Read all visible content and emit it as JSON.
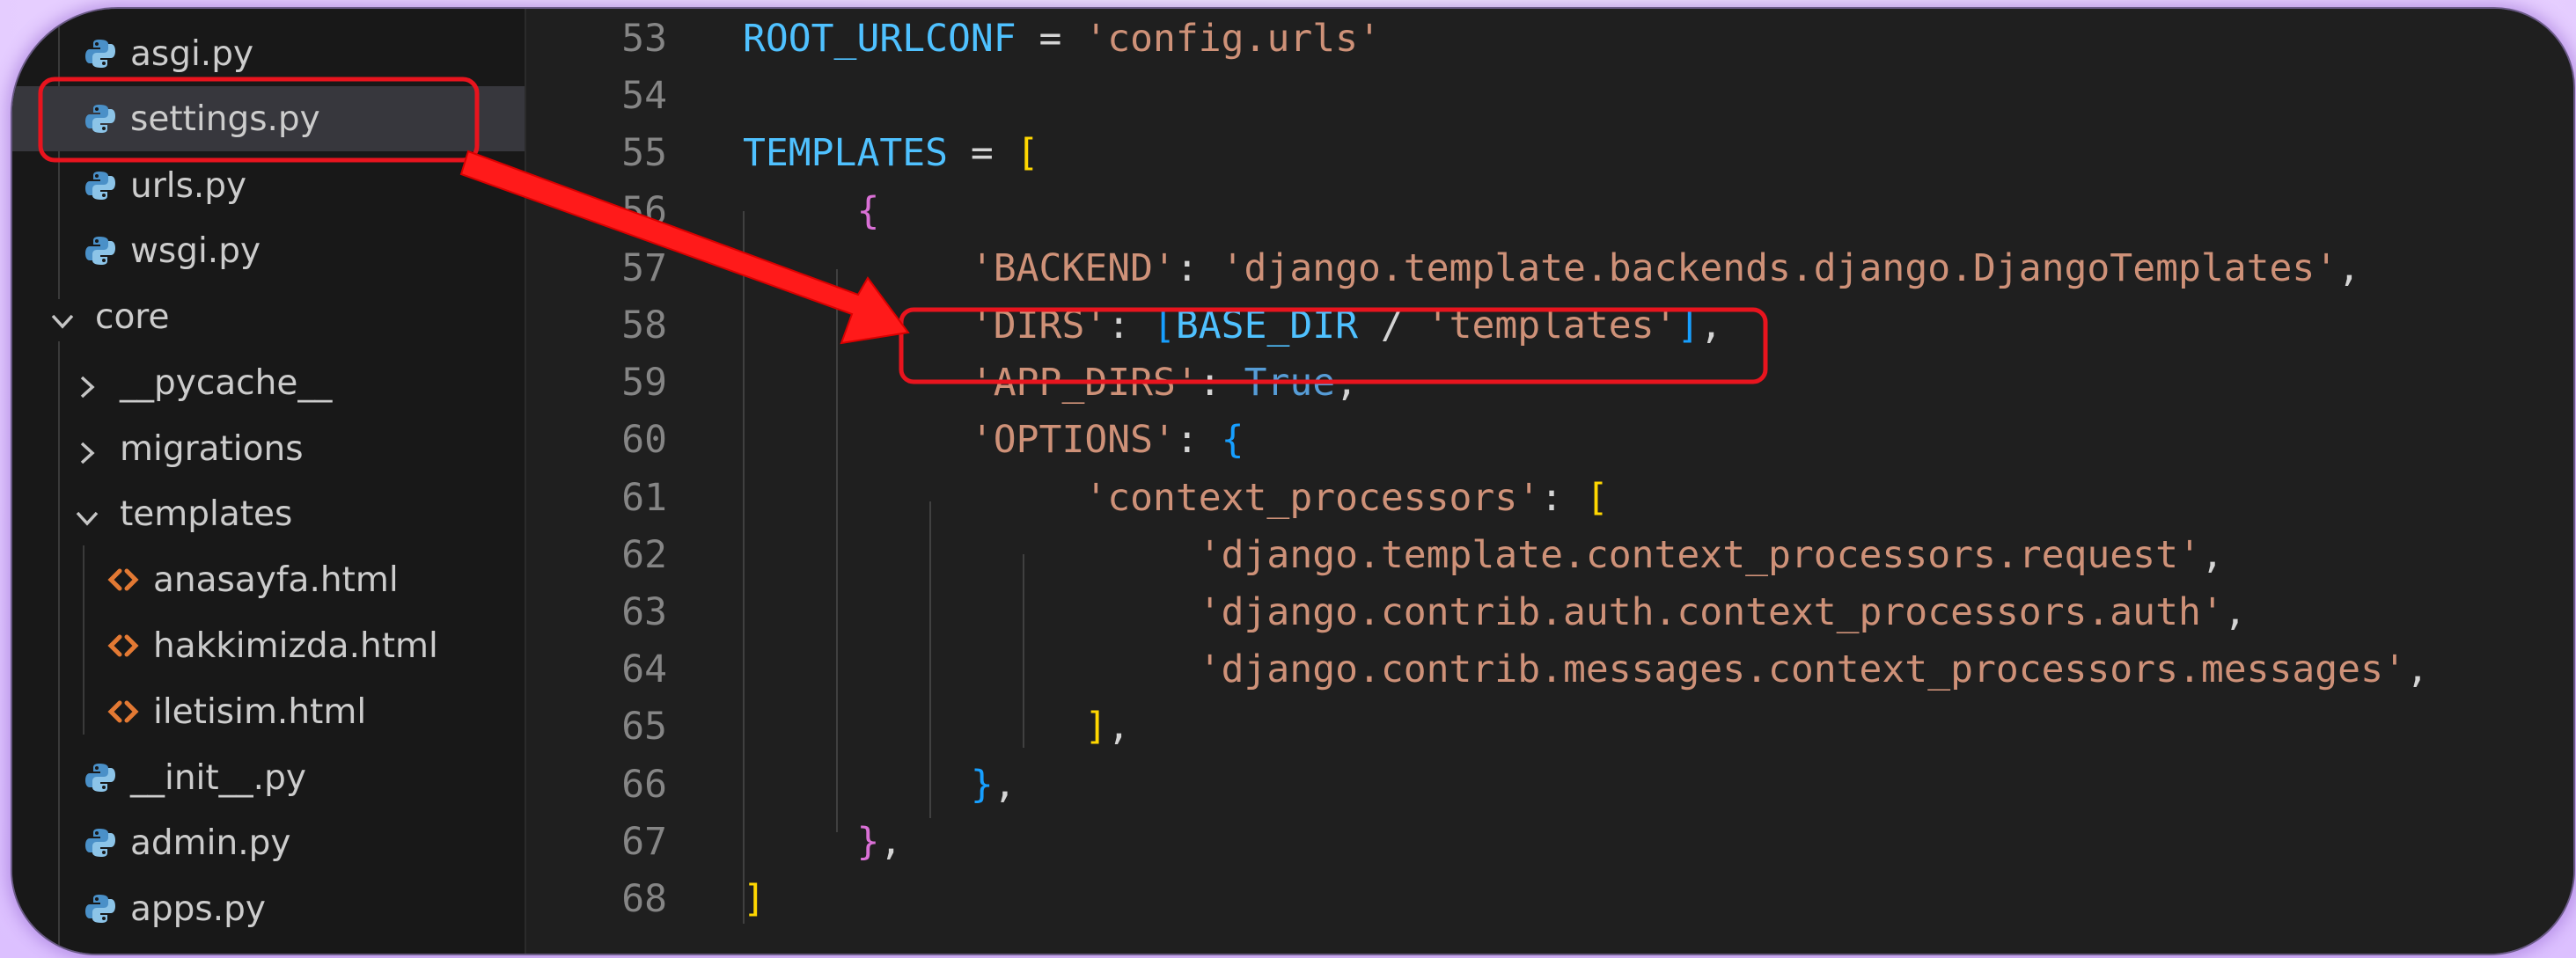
{
  "explorer": {
    "items": [
      {
        "label": "asgi.py",
        "type": "python"
      },
      {
        "label": "settings.py",
        "type": "python",
        "selected": true
      },
      {
        "label": "urls.py",
        "type": "python"
      },
      {
        "label": "wsgi.py",
        "type": "python"
      },
      {
        "label": "core",
        "type": "folder-open"
      },
      {
        "label": "__pycache__",
        "type": "folder-closed"
      },
      {
        "label": "migrations",
        "type": "folder-closed"
      },
      {
        "label": "templates",
        "type": "folder-open"
      },
      {
        "label": "anasayfa.html",
        "type": "html"
      },
      {
        "label": "hakkimizda.html",
        "type": "html"
      },
      {
        "label": "iletisim.html",
        "type": "html"
      },
      {
        "label": "__init__.py",
        "type": "python"
      },
      {
        "label": "admin.py",
        "type": "python"
      },
      {
        "label": "apps.py",
        "type": "python"
      }
    ]
  },
  "editor": {
    "lines": [
      {
        "num": "53",
        "tokens": [
          [
            "ROOT_URLCONF",
            "t-id"
          ],
          [
            " = ",
            "t-op"
          ],
          [
            "'config.urls'",
            "t-str"
          ]
        ]
      },
      {
        "num": "54",
        "tokens": []
      },
      {
        "num": "55",
        "tokens": [
          [
            "TEMPLATES",
            "t-id"
          ],
          [
            " = ",
            "t-op"
          ],
          [
            "[",
            "b1"
          ]
        ]
      },
      {
        "num": "56",
        "tokens": [
          [
            "     ",
            "t-op"
          ],
          [
            "{",
            "b2"
          ]
        ]
      },
      {
        "num": "57",
        "tokens": [
          [
            "          ",
            "t-op"
          ],
          [
            "'BACKEND'",
            "t-str"
          ],
          [
            ": ",
            "t-op"
          ],
          [
            "'django.template.backends.django.DjangoTemplates'",
            "t-str"
          ],
          [
            ",",
            "t-op"
          ]
        ]
      },
      {
        "num": "58",
        "tokens": [
          [
            "          ",
            "t-op"
          ],
          [
            "'DIRS'",
            "t-str"
          ],
          [
            ": ",
            "t-op"
          ],
          [
            "[",
            "b3"
          ],
          [
            "BASE_DIR",
            "t-id"
          ],
          [
            " / ",
            "t-op"
          ],
          [
            "'templates'",
            "t-str"
          ],
          [
            "]",
            "b3"
          ],
          [
            ",",
            "t-op"
          ]
        ]
      },
      {
        "num": "59",
        "tokens": [
          [
            "          ",
            "t-op"
          ],
          [
            "'APP_DIRS'",
            "t-str"
          ],
          [
            ": ",
            "t-op"
          ],
          [
            "True",
            "t-kw"
          ],
          [
            ",",
            "t-op"
          ]
        ]
      },
      {
        "num": "60",
        "tokens": [
          [
            "          ",
            "t-op"
          ],
          [
            "'OPTIONS'",
            "t-str"
          ],
          [
            ": ",
            "t-op"
          ],
          [
            "{",
            "b3"
          ]
        ]
      },
      {
        "num": "61",
        "tokens": [
          [
            "               ",
            "t-op"
          ],
          [
            "'context_processors'",
            "t-str"
          ],
          [
            ": ",
            "t-op"
          ],
          [
            "[",
            "b1"
          ]
        ]
      },
      {
        "num": "62",
        "tokens": [
          [
            "                    ",
            "t-op"
          ],
          [
            "'django.template.context_processors.request'",
            "t-str"
          ],
          [
            ",",
            "t-op"
          ]
        ]
      },
      {
        "num": "63",
        "tokens": [
          [
            "                    ",
            "t-op"
          ],
          [
            "'django.contrib.auth.context_processors.auth'",
            "t-str"
          ],
          [
            ",",
            "t-op"
          ]
        ]
      },
      {
        "num": "64",
        "tokens": [
          [
            "                    ",
            "t-op"
          ],
          [
            "'django.contrib.messages.context_processors.messages'",
            "t-str"
          ],
          [
            ",",
            "t-op"
          ]
        ]
      },
      {
        "num": "65",
        "tokens": [
          [
            "               ",
            "t-op"
          ],
          [
            "]",
            "b1"
          ],
          [
            ",",
            "t-op"
          ]
        ]
      },
      {
        "num": "66",
        "tokens": [
          [
            "          ",
            "t-op"
          ],
          [
            "}",
            "b3"
          ],
          [
            ",",
            "t-op"
          ]
        ]
      },
      {
        "num": "67",
        "tokens": [
          [
            "     ",
            "t-op"
          ],
          [
            "}",
            "b2"
          ],
          [
            ",",
            "t-op"
          ]
        ]
      },
      {
        "num": "68",
        "tokens": [
          [
            "]",
            "b1"
          ]
        ]
      }
    ]
  },
  "annotations": {
    "highlight_color": "#e8141e",
    "arrow_color": "#ff1a1a"
  }
}
